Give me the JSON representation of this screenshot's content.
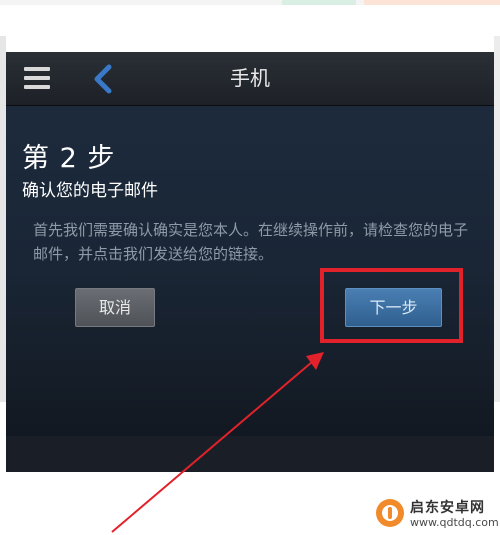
{
  "header": {
    "title": "手机"
  },
  "icons": {
    "menu": "hamburger-menu-icon",
    "back": "chevron-left-icon"
  },
  "step": {
    "title": "第 2 步",
    "subtitle": "确认您的电子邮件"
  },
  "description": "首先我们需要确认确实是您本人。在继续操作前，请检查您的电子邮件，并点击我们发送给您的链接。",
  "buttons": {
    "cancel": "取消",
    "next": "下一步"
  },
  "watermark": {
    "name": "启东安卓网",
    "url": "www.qdtdq.com"
  },
  "colors": {
    "accent_blue": "#3a78c8",
    "annotation_red": "#e2222a",
    "next_button": "#3b6e9f"
  }
}
